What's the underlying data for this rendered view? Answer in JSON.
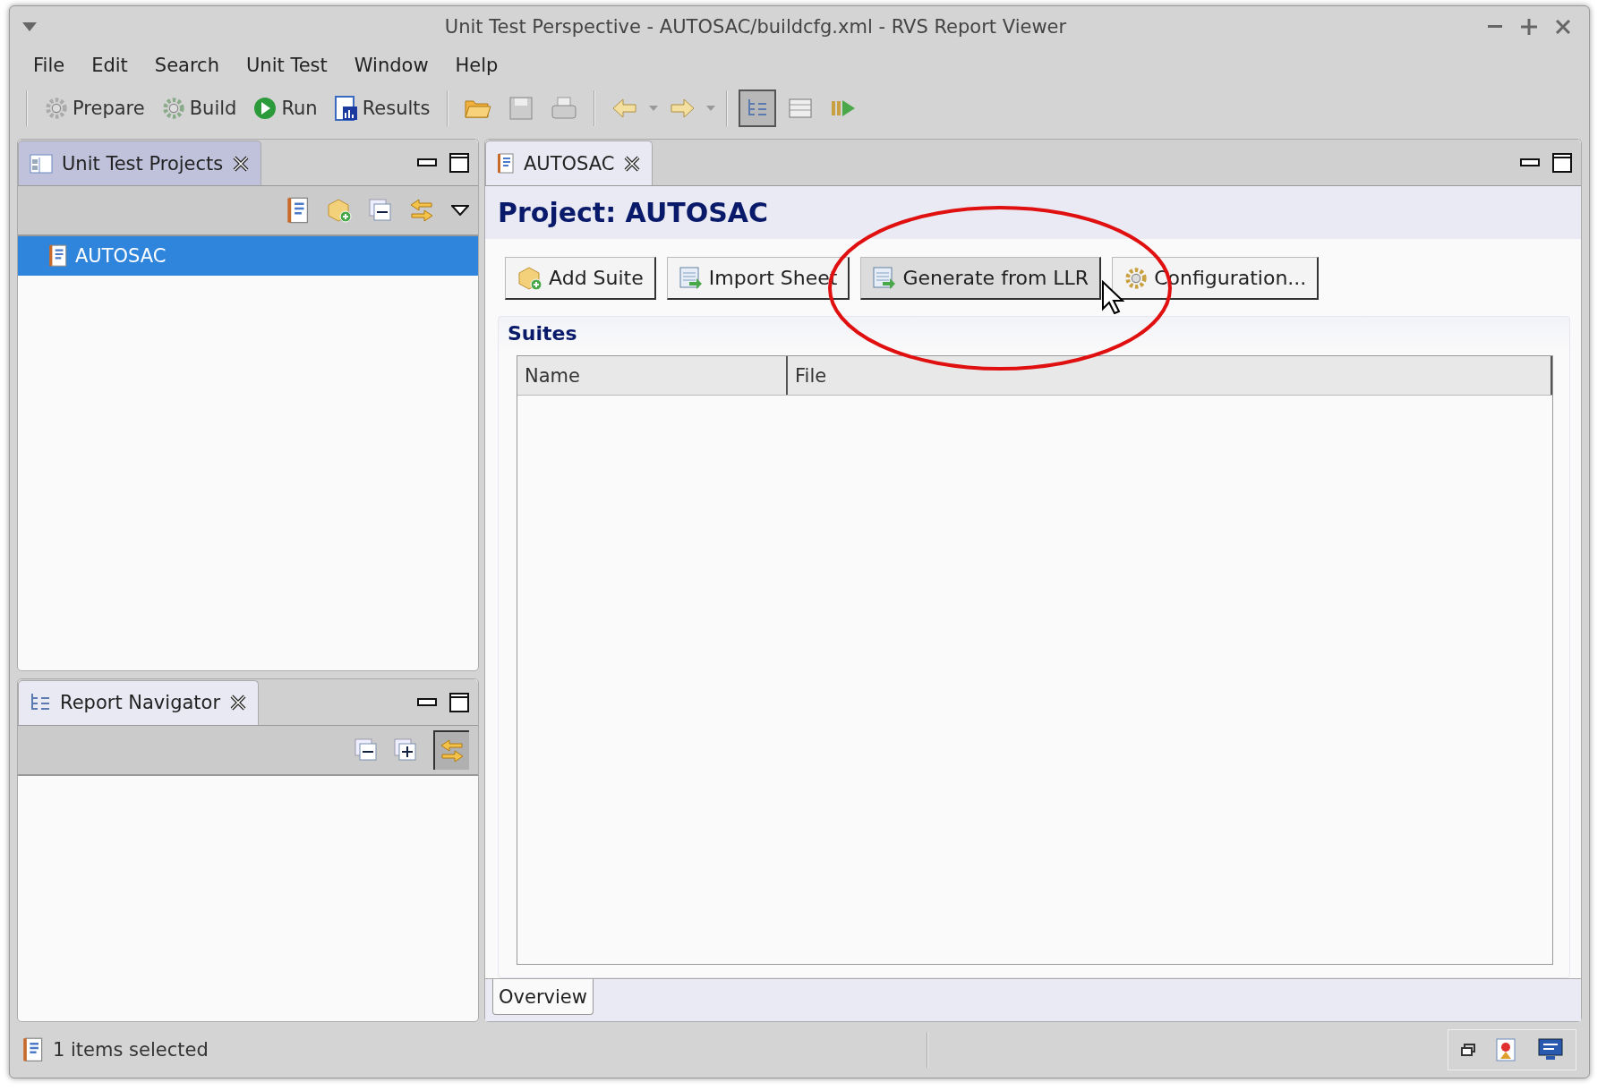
{
  "window": {
    "title": "Unit Test Perspective - AUTOSAC/buildcfg.xml - RVS Report Viewer"
  },
  "menu": [
    "File",
    "Edit",
    "Search",
    "Unit Test",
    "Window",
    "Help"
  ],
  "toolbar": {
    "actions": [
      "Prepare",
      "Build",
      "Run",
      "Results"
    ],
    "view_buttons": [
      {
        "selected": true
      },
      {
        "selected": false
      },
      {
        "selected": false
      }
    ]
  },
  "projects_panel": {
    "title": "Unit Test Projects",
    "active": true,
    "items": [
      {
        "label": "AUTOSAC",
        "selected": true
      }
    ]
  },
  "navigator_panel": {
    "title": "Report Navigator",
    "active": false,
    "link_pressed": true
  },
  "editor": {
    "tab": "AUTOSAC",
    "heading": "Project: AUTOSAC",
    "buttons": [
      {
        "label": "Add Suite",
        "hovered": false
      },
      {
        "label": "Import Sheet",
        "hovered": false
      },
      {
        "label": "Generate from LLR",
        "hovered": true
      },
      {
        "label": "Configuration...",
        "hovered": false
      }
    ],
    "section": "Suites",
    "table": {
      "columns": [
        "Name",
        "File"
      ]
    },
    "bottom_tabs": [
      {
        "label": "Overview",
        "selected": true
      }
    ]
  },
  "status_bar": {
    "text": "1 items selected"
  }
}
